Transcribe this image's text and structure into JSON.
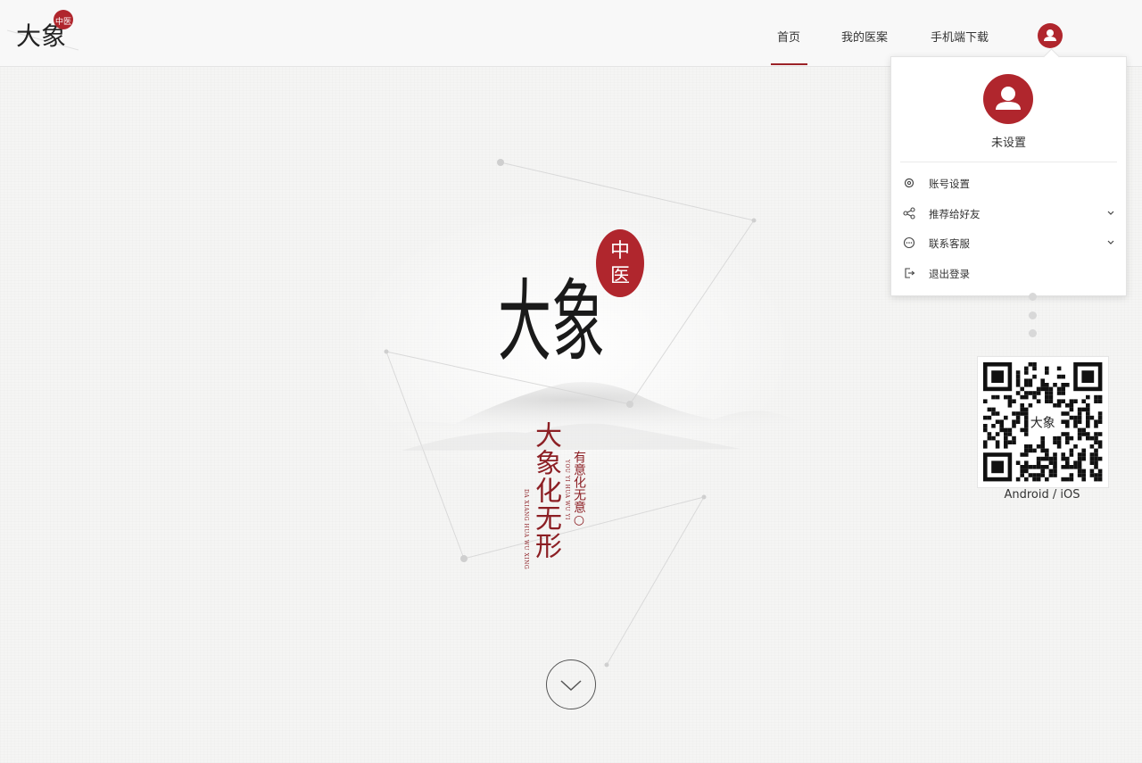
{
  "brand": {
    "logo_text": "大象",
    "seal_text": "中医"
  },
  "nav": {
    "items": [
      {
        "label": "首页",
        "active": true
      },
      {
        "label": "我的医案",
        "active": false
      },
      {
        "label": "手机端下载",
        "active": false
      }
    ],
    "user_icon": "user-icon"
  },
  "user_menu": {
    "avatar_icon": "user-icon",
    "username": "未设置",
    "items": [
      {
        "label": "账号设置",
        "icon": "gear-icon",
        "expandable": false
      },
      {
        "label": "推荐给好友",
        "icon": "share-icon",
        "expandable": true
      },
      {
        "label": "联系客服",
        "icon": "chat-icon",
        "expandable": true
      },
      {
        "label": "退出登录",
        "icon": "logout-icon",
        "expandable": false
      }
    ]
  },
  "download": {
    "qr_icon": "qr-code",
    "label": "Android / iOS"
  },
  "hero": {
    "logo_text": "大象",
    "seal_text": "中医",
    "slogan_main": "大象化无形",
    "slogan_sub": "有意化无意○",
    "pinyin_main": "DA XIANG HUA WU XING",
    "pinyin_sub": "YOU YI HUA WU YI"
  },
  "colors": {
    "accent": "#9b2227",
    "seal": "#b0262d",
    "slogan": "#8c1f24",
    "background": "#f5f5f4"
  }
}
